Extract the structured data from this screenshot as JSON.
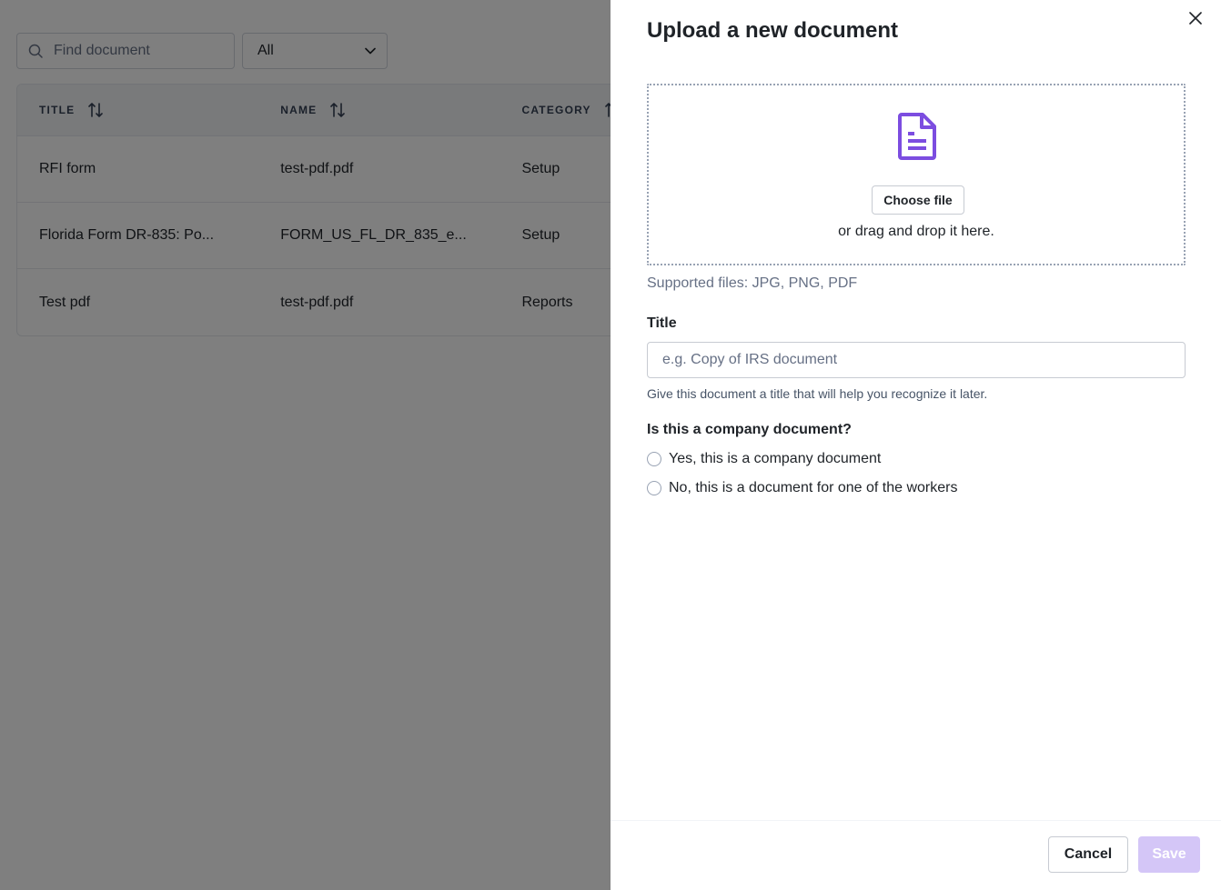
{
  "background": {
    "search": {
      "placeholder": "Find document"
    },
    "filter": {
      "selected": "All"
    },
    "table": {
      "columns": [
        "TITLE",
        "NAME",
        "CATEGORY"
      ],
      "rows": [
        {
          "title": "RFI form",
          "name": "test-pdf.pdf",
          "category": "Setup"
        },
        {
          "title": "Florida Form DR-835: Po...",
          "name": "FORM_US_FL_DR_835_e...",
          "category": "Setup"
        },
        {
          "title": "Test pdf",
          "name": "test-pdf.pdf",
          "category": "Reports"
        }
      ]
    }
  },
  "drawer": {
    "title": "Upload a new document",
    "upload": {
      "choose_label": "Choose file",
      "drop_text": "or drag and drop it here.",
      "supported": "Supported files: JPG, PNG, PDF",
      "icon": "document-icon"
    },
    "title_field": {
      "label": "Title",
      "placeholder": "e.g. Copy of IRS document",
      "value": "",
      "hint": "Give this document a title that will help you recognize it later."
    },
    "company_question": {
      "label": "Is this a company document?",
      "options": [
        "Yes, this is a company document",
        "No, this is a document for one of the workers"
      ]
    },
    "footer": {
      "cancel_label": "Cancel",
      "save_label": "Save"
    }
  },
  "colors": {
    "accent": "#7c4de0",
    "save_disabled_bg": "#d4c6f7",
    "overlay": "rgba(0,0,0,0.5)"
  }
}
